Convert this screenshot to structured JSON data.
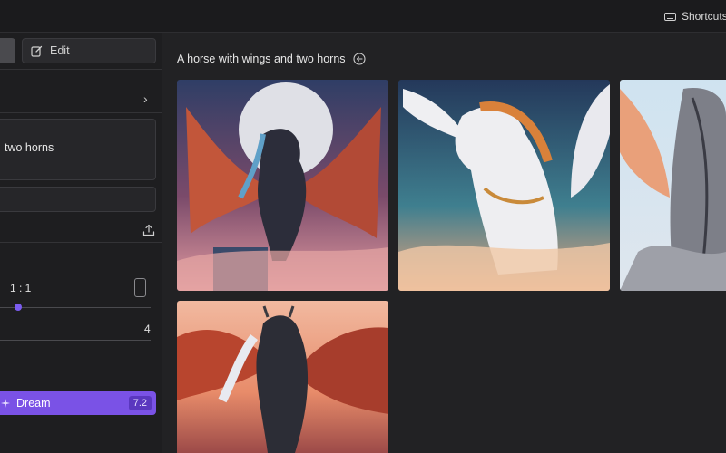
{
  "topbar": {
    "shortcuts_label": "Shortcuts"
  },
  "sidebar": {
    "edit_label": "Edit",
    "prompt_text": "two horns",
    "aspect_ratio": "1 : 1",
    "image_count": "4",
    "slider_value_fraction": 0.12,
    "dream_label": "Dream",
    "dream_cost": "7.2"
  },
  "main": {
    "prompt_title": "A horse with wings and two horns",
    "images": [
      {
        "name": "winged-dark-horse-moon",
        "accent": "#c85a3a"
      },
      {
        "name": "white-winged-horse-gold",
        "accent": "#e8e4e6"
      },
      {
        "name": "grey-winged-horse-partial",
        "accent": "#9a9aa0"
      },
      {
        "name": "horned-winged-horse-clouds",
        "accent": "#d0603e"
      }
    ]
  },
  "colors": {
    "accent": "#7a52e6",
    "background": "#222224",
    "sidebar": "#1e1e20"
  }
}
